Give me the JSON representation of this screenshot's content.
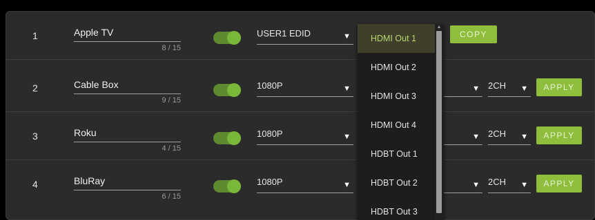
{
  "inputs": [
    {
      "index": "1",
      "name": "Apple TV",
      "count": "8 / 15",
      "enabled": true,
      "edid": "USER1 EDID"
    },
    {
      "index": "2",
      "name": "Cable Box",
      "count": "9 / 15",
      "enabled": true,
      "edid": "1080P",
      "audio": "2CH",
      "apply_label": "APPLY"
    },
    {
      "index": "3",
      "name": "Roku",
      "count": "4 / 15",
      "enabled": true,
      "edid": "1080P",
      "audio": "2CH",
      "apply_label": "APPLY"
    },
    {
      "index": "4",
      "name": "BluRay",
      "count": "6 / 15",
      "enabled": true,
      "edid": "1080P",
      "audio": "2CH",
      "apply_label": "APPLY"
    }
  ],
  "copy_label": "COPY",
  "dropdown": {
    "selected": "HDMI Out 1",
    "options": [
      "HDMI Out 1",
      "HDMI Out 2",
      "HDMI Out 3",
      "HDMI Out 4",
      "HDBT Out 1",
      "HDBT Out 2",
      "HDBT Out 3"
    ]
  },
  "colors": {
    "accent": "#8fbe3d",
    "toggle_on": "#7ab83a",
    "panel": "#2b2b2b",
    "dropdown_bg": "#1d1d1d"
  }
}
